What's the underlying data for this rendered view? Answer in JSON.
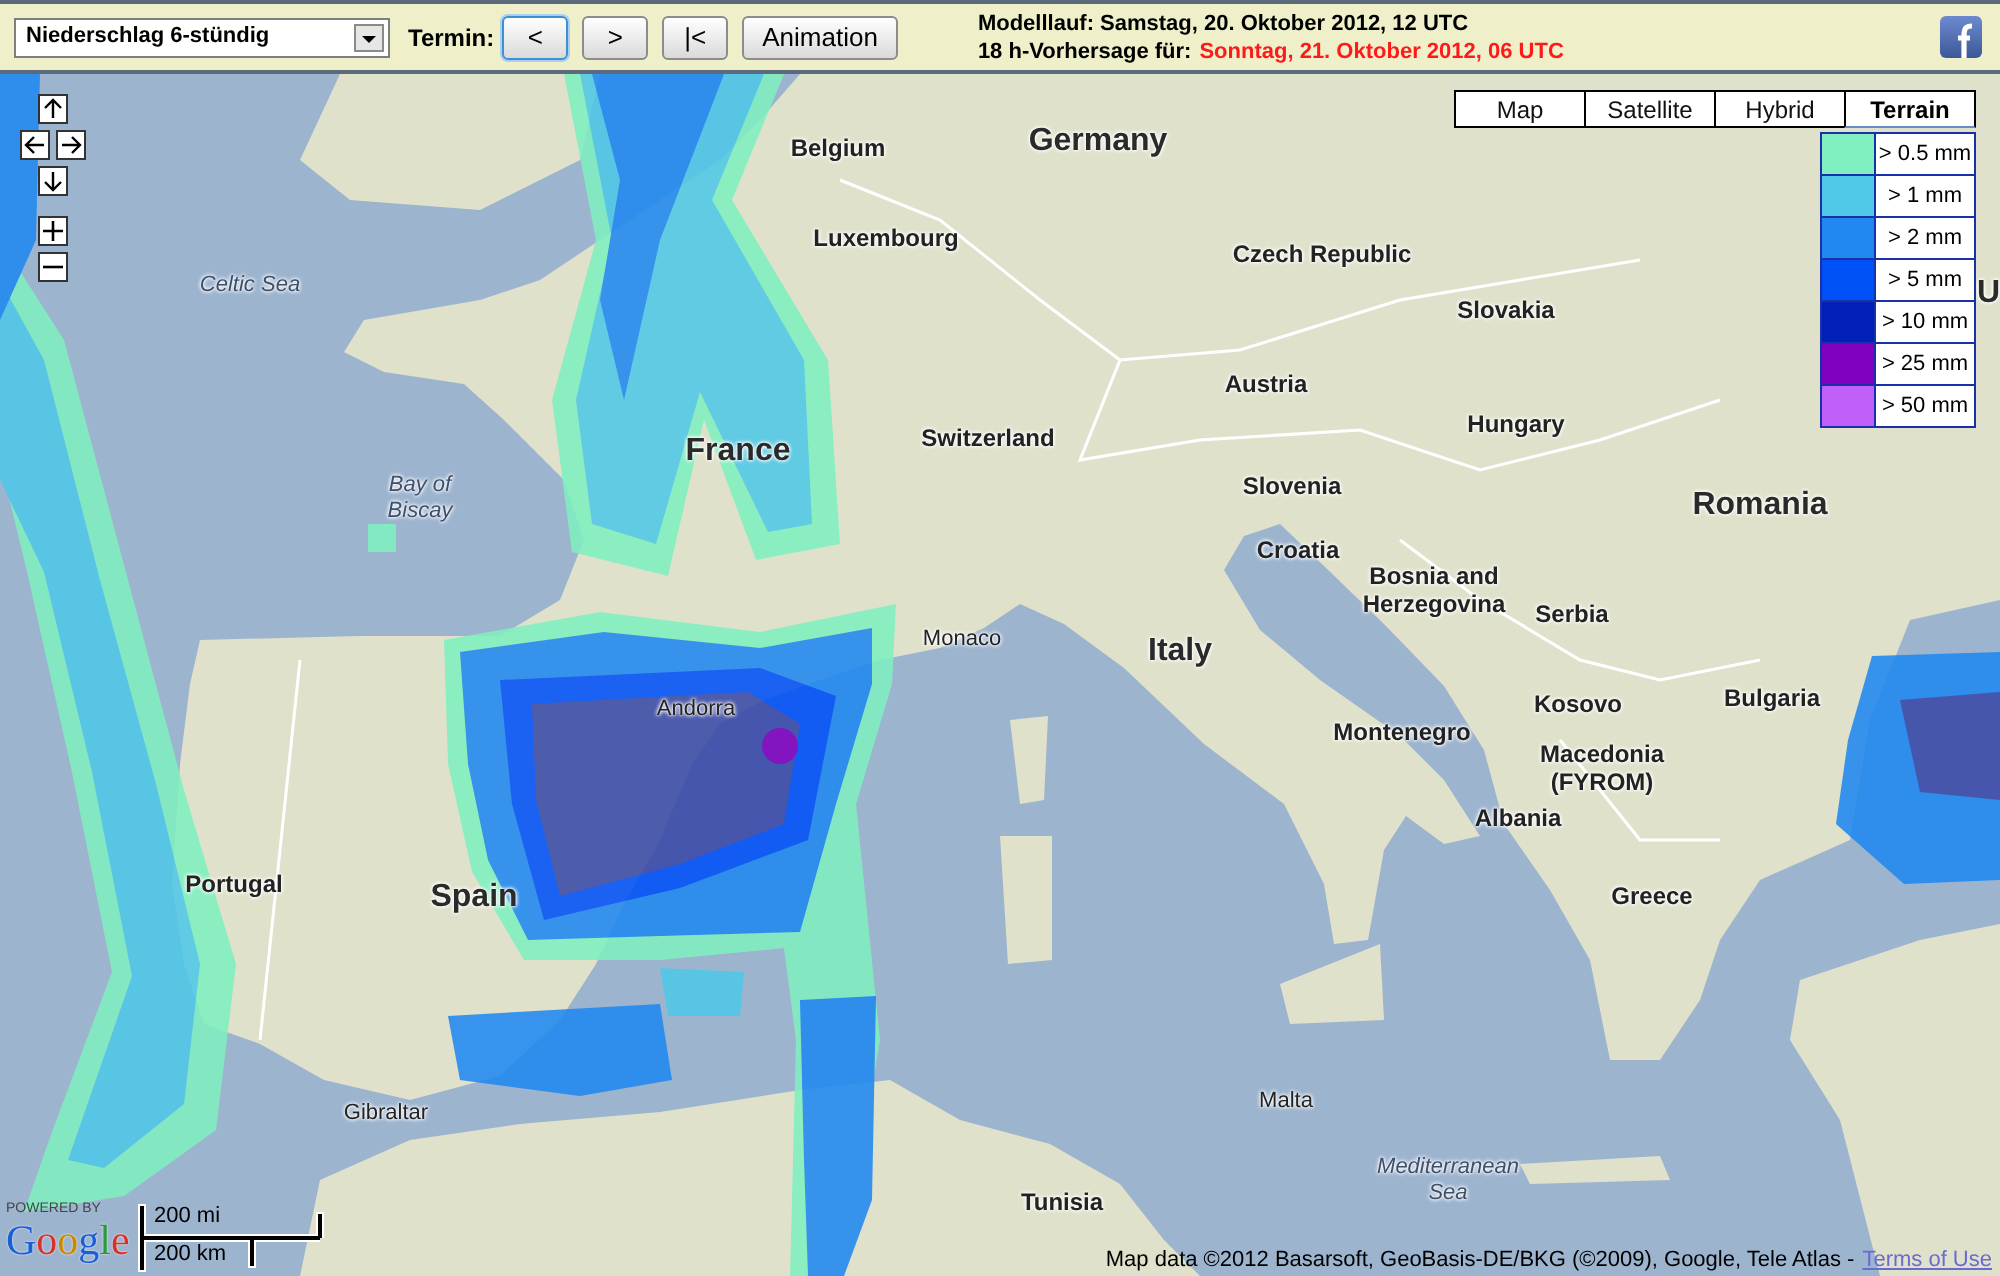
{
  "toolbar": {
    "product_select": {
      "value": "Niederschlag 6-stündig"
    },
    "termin_label": "Termin:",
    "buttons": [
      {
        "label": "<",
        "focused": true
      },
      {
        "label": ">",
        "focused": false
      },
      {
        "label": "|<",
        "focused": false
      },
      {
        "label": "Animation",
        "focused": false
      }
    ]
  },
  "run_info": {
    "model_run": "Modelllauf: Samstag, 20. Oktober 2012, 12 UTC",
    "forecast_label": "18 h-Vorhersage für:",
    "forecast_time": "Sonntag, 21. Oktober 2012, 06 UTC"
  },
  "map": {
    "map_types": [
      {
        "label": "Map",
        "selected": false
      },
      {
        "label": "Satellite",
        "selected": false
      },
      {
        "label": "Hybrid",
        "selected": false
      },
      {
        "label": "Terrain",
        "selected": true
      }
    ],
    "legend": [
      {
        "label": "> 0.5 mm",
        "color": "#80f0c0"
      },
      {
        "label": "> 1 mm",
        "color": "#50c8e8"
      },
      {
        "label": "> 2 mm",
        "color": "#2088f0"
      },
      {
        "label": "> 5 mm",
        "color": "#0050f8"
      },
      {
        "label": "> 10 mm",
        "color": "#0020b8"
      },
      {
        "label": "> 25 mm",
        "color": "#8000c0"
      },
      {
        "label": "> 50 mm",
        "color": "#c060f8"
      }
    ],
    "labels": [
      {
        "text": "Belgium",
        "kind": "country"
      },
      {
        "text": "Germany",
        "kind": "large"
      },
      {
        "text": "Luxembourg",
        "kind": "country"
      },
      {
        "text": "Czech Republic",
        "kind": "country"
      },
      {
        "text": "Celtic Sea",
        "kind": "sea"
      },
      {
        "text": "Slovakia",
        "kind": "country"
      },
      {
        "text": "U",
        "kind": "large"
      },
      {
        "text": "Austria",
        "kind": "country"
      },
      {
        "text": "France",
        "kind": "large"
      },
      {
        "text": "Switzerland",
        "kind": "country"
      },
      {
        "text": "Hungary",
        "kind": "country"
      },
      {
        "text": "Bay of\nBiscay",
        "kind": "sea"
      },
      {
        "text": "Slovenia",
        "kind": "country"
      },
      {
        "text": "Romania",
        "kind": "large"
      },
      {
        "text": "Croatia",
        "kind": "country"
      },
      {
        "text": "Bosnia and\nHerzegovina",
        "kind": "country"
      },
      {
        "text": "Serbia",
        "kind": "country"
      },
      {
        "text": "Monaco",
        "kind": "minor"
      },
      {
        "text": "Italy",
        "kind": "large"
      },
      {
        "text": "Andorra",
        "kind": "minor"
      },
      {
        "text": "Kosovo",
        "kind": "country"
      },
      {
        "text": "Bulgaria",
        "kind": "country"
      },
      {
        "text": "Montenegro",
        "kind": "country"
      },
      {
        "text": "Macedonia\n(FYROM)",
        "kind": "country"
      },
      {
        "text": "Albania",
        "kind": "country"
      },
      {
        "text": "Portugal",
        "kind": "country"
      },
      {
        "text": "Spain",
        "kind": "large"
      },
      {
        "text": "Greece",
        "kind": "country"
      },
      {
        "text": "Gibraltar",
        "kind": "minor"
      },
      {
        "text": "Malta",
        "kind": "minor"
      },
      {
        "text": "Tunisia",
        "kind": "country"
      },
      {
        "text": "Mediterranean\nSea",
        "kind": "sea"
      }
    ],
    "logo": {
      "powered_by": "POWERED BY",
      "name": "Google"
    },
    "scale": {
      "miles": "200 mi",
      "kilometers": "200 km"
    },
    "attribution": {
      "text": "Map data ©2012 Basarsoft, GeoBasis-DE/BKG (©2009), Google, Tele Atlas -",
      "link": "Terms of Use"
    }
  }
}
